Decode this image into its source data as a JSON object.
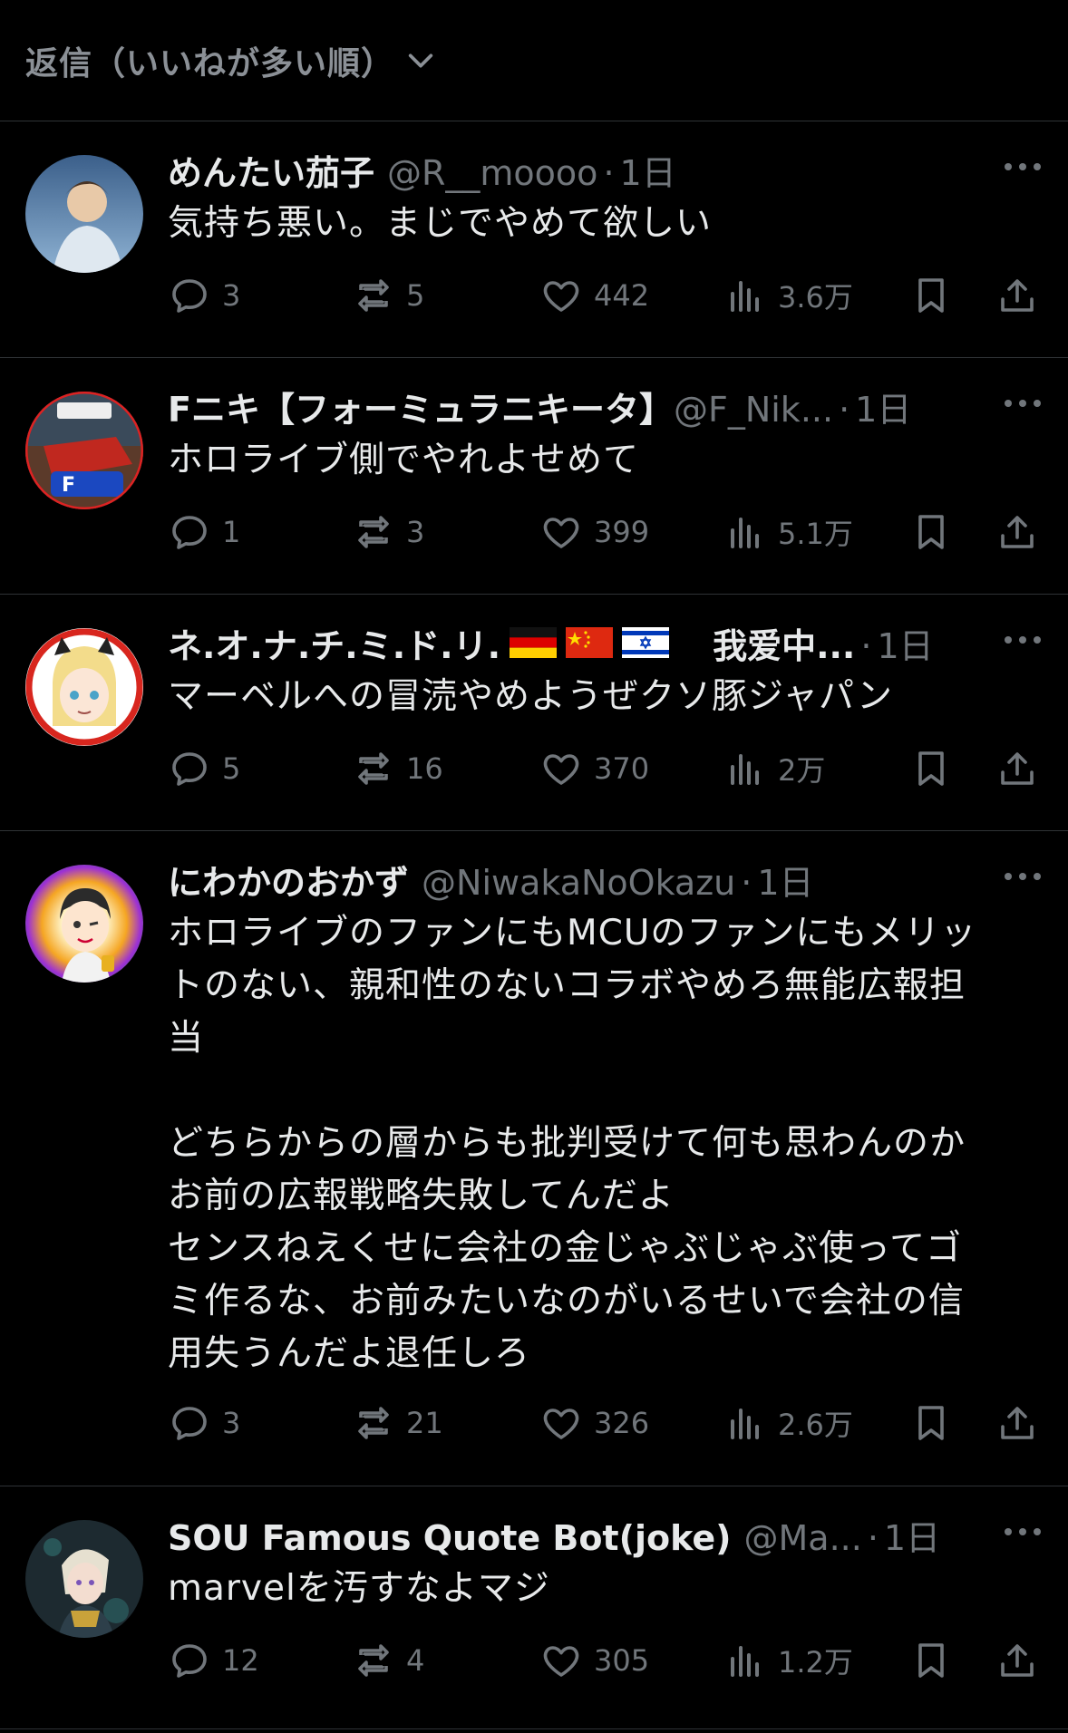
{
  "header": {
    "sort_label": "返信（いいねが多い順）"
  },
  "replies": [
    {
      "name": "めんたい茄子",
      "handle": "@R__moooo",
      "time": "1日",
      "text": "気持ち悪い。まじでやめて欲しい",
      "replies": "3",
      "reposts": "5",
      "likes": "442",
      "views": "3.6万"
    },
    {
      "name": "Fニキ【フォーミュラニキータ】",
      "handle": "@F_Nik...",
      "time": "1日",
      "text": "ホロライブ側でやれよせめて",
      "replies": "1",
      "reposts": "3",
      "likes": "399",
      "views": "5.1万"
    },
    {
      "name": "ネ.オ.ナ.チ.ミ.ド.リ.",
      "name_suffix": "我爱中...",
      "time": "1日",
      "text": "マーベルへの冒涜やめようぜクソ豚ジャパン",
      "replies": "5",
      "reposts": "16",
      "likes": "370",
      "views": "2万"
    },
    {
      "name": "にわかのおかず",
      "handle": "@NiwakaNoOkazu",
      "time": "1日",
      "text": "ホロライブのファンにもMCUのファンにもメリッ\nトのない、親和性のないコラボやめろ無能広報担\n当\n\nどちらからの層からも批判受けて何も思わんのか\nお前の広報戦略失敗してんだよ\nセンスねえくせに会社の金じゃぶじゃぶ使ってゴ\nミ作るな、お前みたいなのがいるせいで会社の信\n用失うんだよ退任しろ",
      "replies": "3",
      "reposts": "21",
      "likes": "326",
      "views": "2.6万"
    },
    {
      "name": "SOU Famous Quote Bot(joke)",
      "handle": "@Ma...",
      "time": "1日",
      "text": "marvelを汚すなよマジ",
      "replies": "12",
      "reposts": "4",
      "likes": "305",
      "views": "1.2万"
    }
  ]
}
